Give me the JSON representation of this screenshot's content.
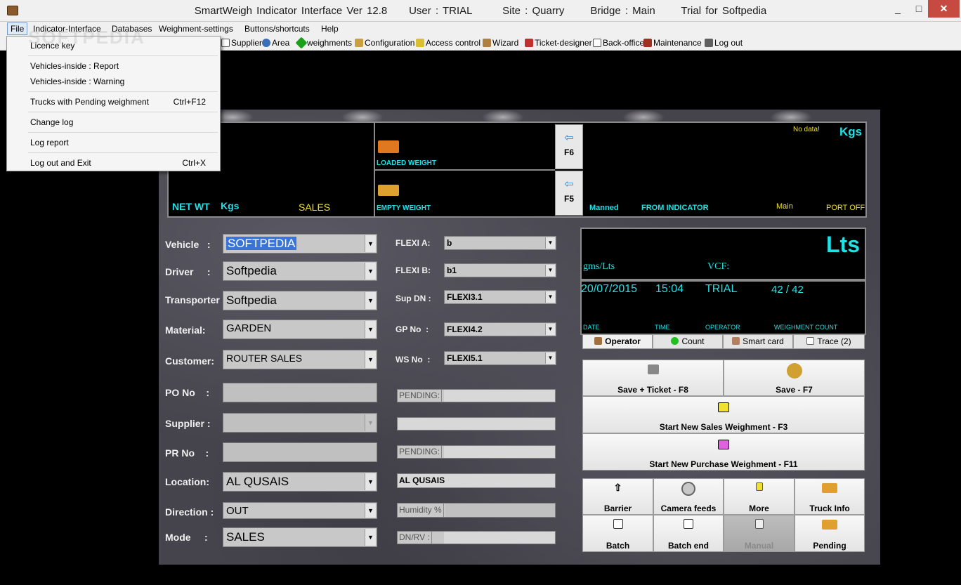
{
  "window": {
    "title": "SmartWeigh Indicator Interface Ver 12.8     User : TRIAL       Site : Quarry      Bridge : Main      Trial for Softpedia",
    "minimize": "_",
    "maximize": "□",
    "close": "✕"
  },
  "menubar": [
    "File",
    "Indicator-Interface",
    "Databases",
    "Weighment-settings",
    "Buttons/shortcuts",
    "Help"
  ],
  "toolbar": [
    "Supplier",
    "Area",
    "weighments",
    "Configuration",
    "Access control",
    "Wizard",
    "Ticket-designer",
    "Back-office",
    "Maintenance",
    "Log out"
  ],
  "file_menu": {
    "items": [
      {
        "label": "Licence key",
        "shortcut": ""
      },
      {
        "label": "Vehicles-inside : Report",
        "shortcut": ""
      },
      {
        "label": "Vehicles-inside : Warning",
        "shortcut": ""
      },
      {
        "label": "Trucks with Pending weighment",
        "shortcut": "Ctrl+F12"
      },
      {
        "label": "Change log",
        "shortcut": ""
      },
      {
        "label": "Log report",
        "shortcut": ""
      },
      {
        "label": "Log out and Exit",
        "shortcut": "Ctrl+X"
      }
    ]
  },
  "weight_panel": {
    "net_wt": "NET WT",
    "net_unit": "Kgs",
    "mode": "SALES",
    "loaded_weight": "LOADED WEIGHT",
    "empty_weight": "EMPTY WEIGHT",
    "f6": "F6",
    "f5": "F5",
    "no_data": "No data!",
    "unit": "Kgs",
    "manned": "Manned",
    "from_indicator": "FROM INDICATOR",
    "bridge": "Main",
    "port": "PORT OFF"
  },
  "volume_panel": {
    "unit": "Lts",
    "gms_lts": "gms/Lts",
    "vcf": "VCF:"
  },
  "status_panel": {
    "date": "20/07/2015",
    "time": "15:04",
    "operator": "TRIAL",
    "count": "42 / 42",
    "date_label": "DATE",
    "time_label": "TIME",
    "operator_label": "OPERATOR",
    "count_label": "WEIGHMENT COUNT"
  },
  "tabs": [
    "Operator",
    "Count",
    "Smart card",
    "Trace (2)"
  ],
  "form": {
    "vehicle": {
      "label": "Vehicle   :",
      "value": "SOFTPEDIA"
    },
    "driver": {
      "label": "Driver     :",
      "value": "Softpedia"
    },
    "transporter": {
      "label": "Transporter",
      "value": "Softpedia"
    },
    "material": {
      "label": "Material:",
      "value": "GARDEN"
    },
    "customer": {
      "label": "Customer:",
      "value": "ROUTER SALES"
    },
    "po_no": {
      "label": "PO No    :",
      "value": ""
    },
    "supplier": {
      "label": "Supplier :",
      "value": ""
    },
    "pr_no": {
      "label": "PR No    :",
      "value": ""
    },
    "location": {
      "label": "Location:",
      "value": "AL QUSAIS"
    },
    "direction": {
      "label": "Direction :",
      "value": "OUT"
    },
    "mode": {
      "label": "Mode     :",
      "value": "SALES"
    }
  },
  "flexi": {
    "a": {
      "label": "FLEXI A:",
      "value": "b"
    },
    "b": {
      "label": "FLEXI B:",
      "value": "b1"
    },
    "sup_dn": {
      "label": "Sup DN :",
      "value": "FLEXI3.1"
    },
    "gp_no": {
      "label": "GP No  :",
      "value": "FLEXI4.2"
    },
    "ws_no": {
      "label": "WS No  :",
      "value": "FLEXI5.1"
    },
    "pending1": "PENDING:",
    "pending2": "PENDING:",
    "location_text": "AL QUSAIS",
    "humidity": "Humidity %",
    "dn_rv": "DN/RV  :"
  },
  "buttons": {
    "save_ticket": "Save + Ticket - F8",
    "save": "Save - F7",
    "start_sales": "Start New Sales Weighment - F3",
    "start_purchase": "Start New Purchase Weighment - F11",
    "barrier": "Barrier",
    "camera": "Camera feeds",
    "more": "More",
    "truck_info": "Truck Info",
    "batch": "Batch",
    "batch_end": "Batch end",
    "manual": "Manual",
    "pending": "Pending"
  },
  "watermark": "SOFTPEDIA"
}
